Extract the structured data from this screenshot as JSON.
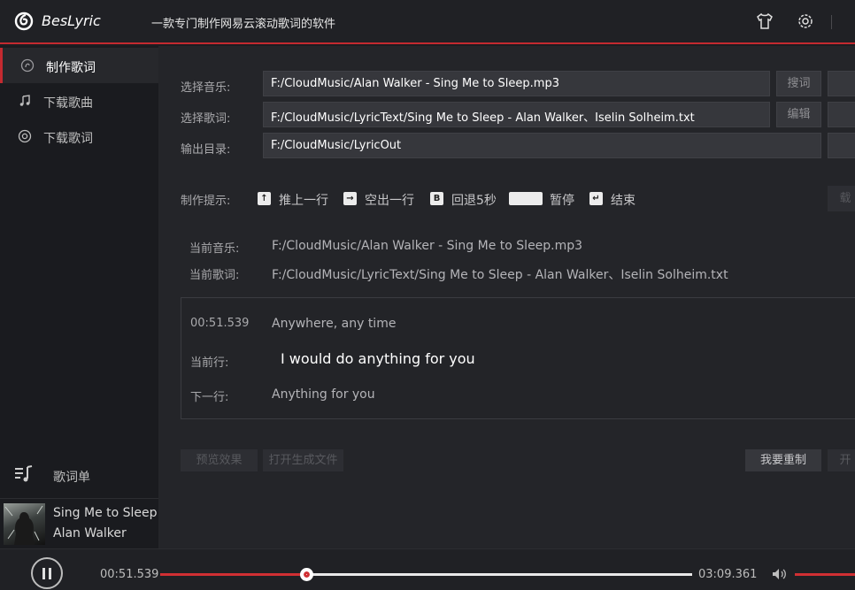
{
  "app": {
    "name": "BesLyric",
    "subtitle": "一款专门制作网易云滚动歌词的软件"
  },
  "sidebar": {
    "items": [
      {
        "label": "制作歌词",
        "icon": "make-lyric-icon",
        "active": true
      },
      {
        "label": "下载歌曲",
        "icon": "music-note-icon",
        "active": false
      },
      {
        "label": "下载歌词",
        "icon": "download-lyric-icon",
        "active": false
      }
    ],
    "lyric_list_label": "歌词单",
    "now_playing": {
      "title": "Sing Me to Sleep",
      "artist": "Alan Walker"
    }
  },
  "form": {
    "music_label": "选择音乐:",
    "music_path": "F:/CloudMusic/Alan Walker - Sing Me to Sleep.mp3",
    "search_btn": "搜词",
    "lyric_label": "选择歌词:",
    "lyric_path": "F:/CloudMusic/LyricText/Sing Me to Sleep - Alan Walker、Iselin Solheim.txt",
    "edit_btn": "编辑",
    "output_label": "输出目录:",
    "output_path": "F:/CloudMusic/LyricOut"
  },
  "hints": {
    "label": "制作提示:",
    "push_key": "↑",
    "push_text": "推上一行",
    "blank_key": "→",
    "blank_text": "空出一行",
    "back_key": "B",
    "back_text": "回退5秒",
    "pause_text": "暂停",
    "end_key": "↵",
    "end_text": "结束",
    "load_btn": "载"
  },
  "current": {
    "music_label": "当前音乐:",
    "music_value": "F:/CloudMusic/Alan Walker - Sing Me to Sleep.mp3",
    "lyric_label": "当前歌词:",
    "lyric_value": "F:/CloudMusic/LyricText/Sing Me to Sleep - Alan Walker、Iselin Solheim.txt"
  },
  "lyric_panel": {
    "prev_time": "00:51.539",
    "prev_line": "Anywhere, any time",
    "current_label": "当前行:",
    "current_line": "I would do anything for you",
    "next_label": "下一行:",
    "next_line": "Anything for you"
  },
  "actions": {
    "preview": "预览效果",
    "open_file": "打开生成文件",
    "redo": "我要重制",
    "start": "开"
  },
  "player": {
    "current_time": "00:51.539",
    "total_time": "03:09.361",
    "progress": 0.274,
    "volume": 1.0,
    "accent": "#d12f33"
  }
}
